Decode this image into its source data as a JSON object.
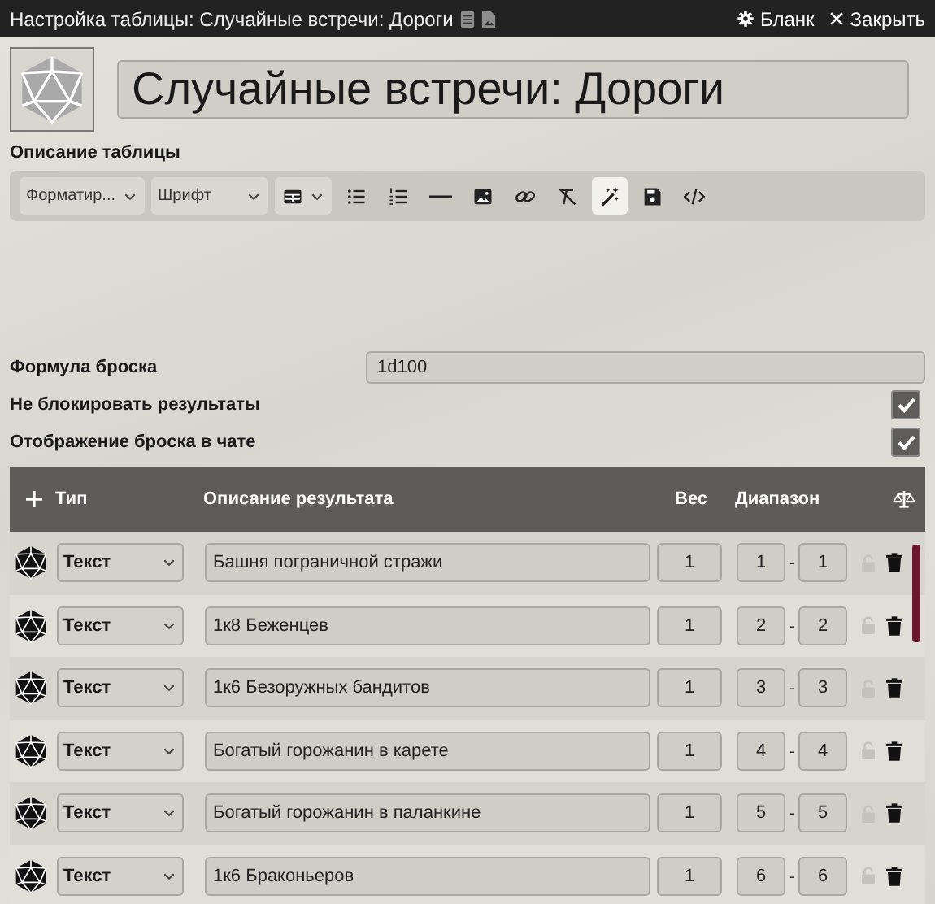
{
  "window": {
    "title": "Настройка таблицы: Случайные встречи: Дороги",
    "buttons": [
      {
        "kind": "sheet",
        "label": "Бланк"
      },
      {
        "kind": "close",
        "label": "Закрыть"
      }
    ]
  },
  "name": "Случайные встречи: Дороги",
  "description": {
    "label": "Описание таблицы",
    "toolbar": [
      {
        "kind": "dropdown",
        "label": "Форматир...",
        "active": false
      },
      {
        "kind": "dropdown",
        "label": "Шрифт",
        "active": false
      },
      {
        "kind": "table",
        "active": false
      },
      {
        "kind": "bullets",
        "active": false
      },
      {
        "kind": "numbers",
        "active": false
      },
      {
        "kind": "rule",
        "active": false
      },
      {
        "kind": "image",
        "active": false
      },
      {
        "kind": "link",
        "active": false
      },
      {
        "kind": "clear",
        "active": false
      },
      {
        "kind": "wand",
        "active": true
      },
      {
        "kind": "save",
        "active": false
      },
      {
        "kind": "code",
        "active": false
      }
    ]
  },
  "formula": {
    "label": "Формула броска",
    "value": "1d100"
  },
  "options": [
    {
      "label": "Не блокировать результаты",
      "checked": true
    },
    {
      "label": "Отображение броска в чате",
      "checked": true
    }
  ],
  "table": {
    "columns": [
      "Тип",
      "Описание результата",
      "Вес",
      "Диапазон"
    ],
    "rows": [
      {
        "type": "Текст",
        "text": "Башня пограничной стражи",
        "weight": "1",
        "from": "1",
        "separator": "-",
        "to": "1",
        "locked": false
      },
      {
        "type": "Текст",
        "text": "1к8 Беженцев",
        "weight": "1",
        "from": "2",
        "separator": "-",
        "to": "2",
        "locked": false
      },
      {
        "type": "Текст",
        "text": "1к6 Безоружных бандитов",
        "weight": "1",
        "from": "3",
        "separator": "-",
        "to": "3",
        "locked": false
      },
      {
        "type": "Текст",
        "text": "Богатый горожанин в карете",
        "weight": "1",
        "from": "4",
        "separator": "-",
        "to": "4",
        "locked": false
      },
      {
        "type": "Текст",
        "text": "Богатый горожанин в паланкине",
        "weight": "1",
        "from": "5",
        "separator": "-",
        "to": "5",
        "locked": false
      },
      {
        "type": "Текст",
        "text": "1к6 Браконьеров",
        "weight": "1",
        "from": "6",
        "separator": "-",
        "to": "6",
        "locked": false
      }
    ]
  }
}
